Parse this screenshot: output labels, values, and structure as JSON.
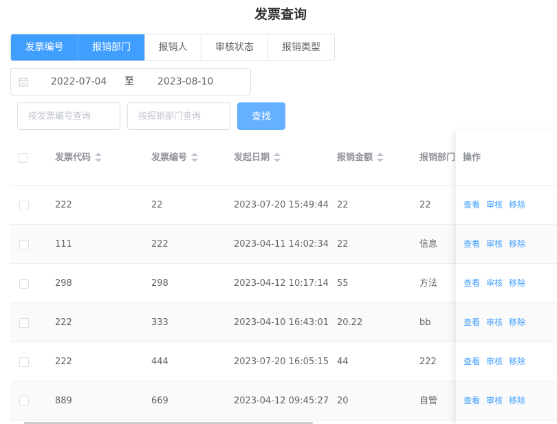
{
  "title": "发票查询",
  "filter_tabs": [
    {
      "label": "发票编号",
      "active": true
    },
    {
      "label": "报销部门",
      "active": true
    },
    {
      "label": "报销人",
      "active": false
    },
    {
      "label": "审核状态",
      "active": false
    },
    {
      "label": "报销类型",
      "active": false
    }
  ],
  "date_range": {
    "start": "2022-07-04",
    "separator": "至",
    "end": "2023-08-10"
  },
  "search": {
    "invoice_no_placeholder": "按发票编号查询",
    "department_placeholder": "按报销部门查询",
    "button_label": "查找"
  },
  "table": {
    "headers": {
      "code": "发票代码",
      "number": "发票编号",
      "date": "发起日期",
      "amount": "报销金额",
      "department": "报销部门",
      "actions": "操作"
    },
    "rows": [
      {
        "code": "222",
        "number": "22",
        "date": "2023-07-20 15:49:44",
        "amount": "22",
        "department": "22"
      },
      {
        "code": "111",
        "number": "222",
        "date": "2023-04-11 14:02:34",
        "amount": "22",
        "department": "信息"
      },
      {
        "code": "298",
        "number": "298",
        "date": "2023-04-12 10:17:14",
        "amount": "55",
        "department": "方法"
      },
      {
        "code": "222",
        "number": "333",
        "date": "2023-04-10 16:43:01",
        "amount": "20.22",
        "department": "bb"
      },
      {
        "code": "222",
        "number": "444",
        "date": "2023-07-20 16:05:15",
        "amount": "44",
        "department": "222"
      },
      {
        "code": "889",
        "number": "669",
        "date": "2023-04-12 09:45:27",
        "amount": "20",
        "department": "自管"
      }
    ],
    "actions": {
      "view": "查看",
      "audit": "审核",
      "remove": "移除"
    }
  },
  "colors": {
    "primary": "#409eff",
    "primary_light": "#66b1ff"
  }
}
